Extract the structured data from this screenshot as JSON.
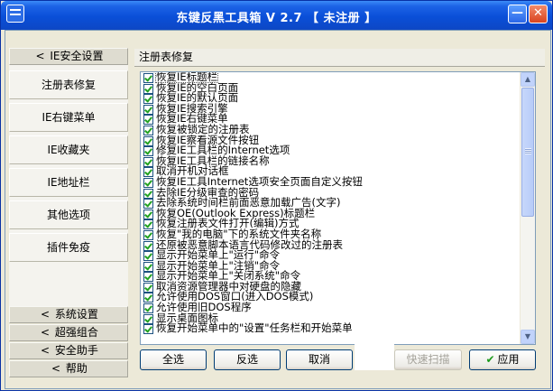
{
  "window": {
    "title": "东键反黑工具箱 V 2.7 【 未注册 】",
    "min_label": "—",
    "close_label": "✕",
    "app_icon": "toolbox-icon"
  },
  "sidebar": {
    "top_header": {
      "chevron": "<",
      "label": "IE安全设置"
    },
    "items": [
      {
        "label": "注册表修复"
      },
      {
        "label": "IE右键菜单"
      },
      {
        "label": "IE收藏夹"
      },
      {
        "label": "IE地址栏"
      },
      {
        "label": "其他选项"
      },
      {
        "label": "插件免疫"
      }
    ],
    "bottom_headers": [
      {
        "chevron": "<",
        "label": "系统设置"
      },
      {
        "chevron": "<",
        "label": "超强组合"
      },
      {
        "chevron": "<",
        "label": "安全助手"
      },
      {
        "chevron": "<",
        "label": "帮助"
      }
    ]
  },
  "main": {
    "section_title": "注册表修复",
    "options": [
      "恢复IE标题栏",
      "恢复IE的空白页面",
      "恢复IE的默认页面",
      "恢复IE搜索引擎",
      "恢复IE右键菜单",
      "恢复被锁定的注册表",
      "恢复IE察看源文件按钮",
      "修复IE工具栏的Internet选项",
      "恢复IE工具栏的链接名称",
      "取消开机对话框",
      "恢复IE工具Internet选项安全页面自定义按钮",
      "去除IE分级审查的密码",
      "去除系统时间栏前面恶意加载广告(文字)",
      "恢复OE(Outlook Express)标题栏",
      "恢复注册表文件打开(编辑)方式",
      "恢复\"我的电脑\"下的系统文件夹名称",
      "还原被恶意脚本语言代码修改过的注册表",
      "显示开始菜单上\"运行\"命令",
      "显示开始菜单上\"注销\"命令",
      "显示开始菜单上\"关闭系统\"命令",
      "取消资源管理器中对硬盘的隐藏",
      "允许使用DOS窗口(进入DOS模式)",
      "允许使用旧DOS程序",
      "显示桌面图标",
      "恢复开始菜单中的\"设置\"任务栏和开始菜单"
    ]
  },
  "buttons": {
    "select_all": "全选",
    "invert": "反选",
    "cancel": "取消",
    "quick_scan": "快速扫描",
    "apply": "应用",
    "apply_icon": "checkmark-icon"
  },
  "colors": {
    "titlebar": "#0a4fd8",
    "check": "#21a121",
    "window_bg": "#ece9d8"
  }
}
